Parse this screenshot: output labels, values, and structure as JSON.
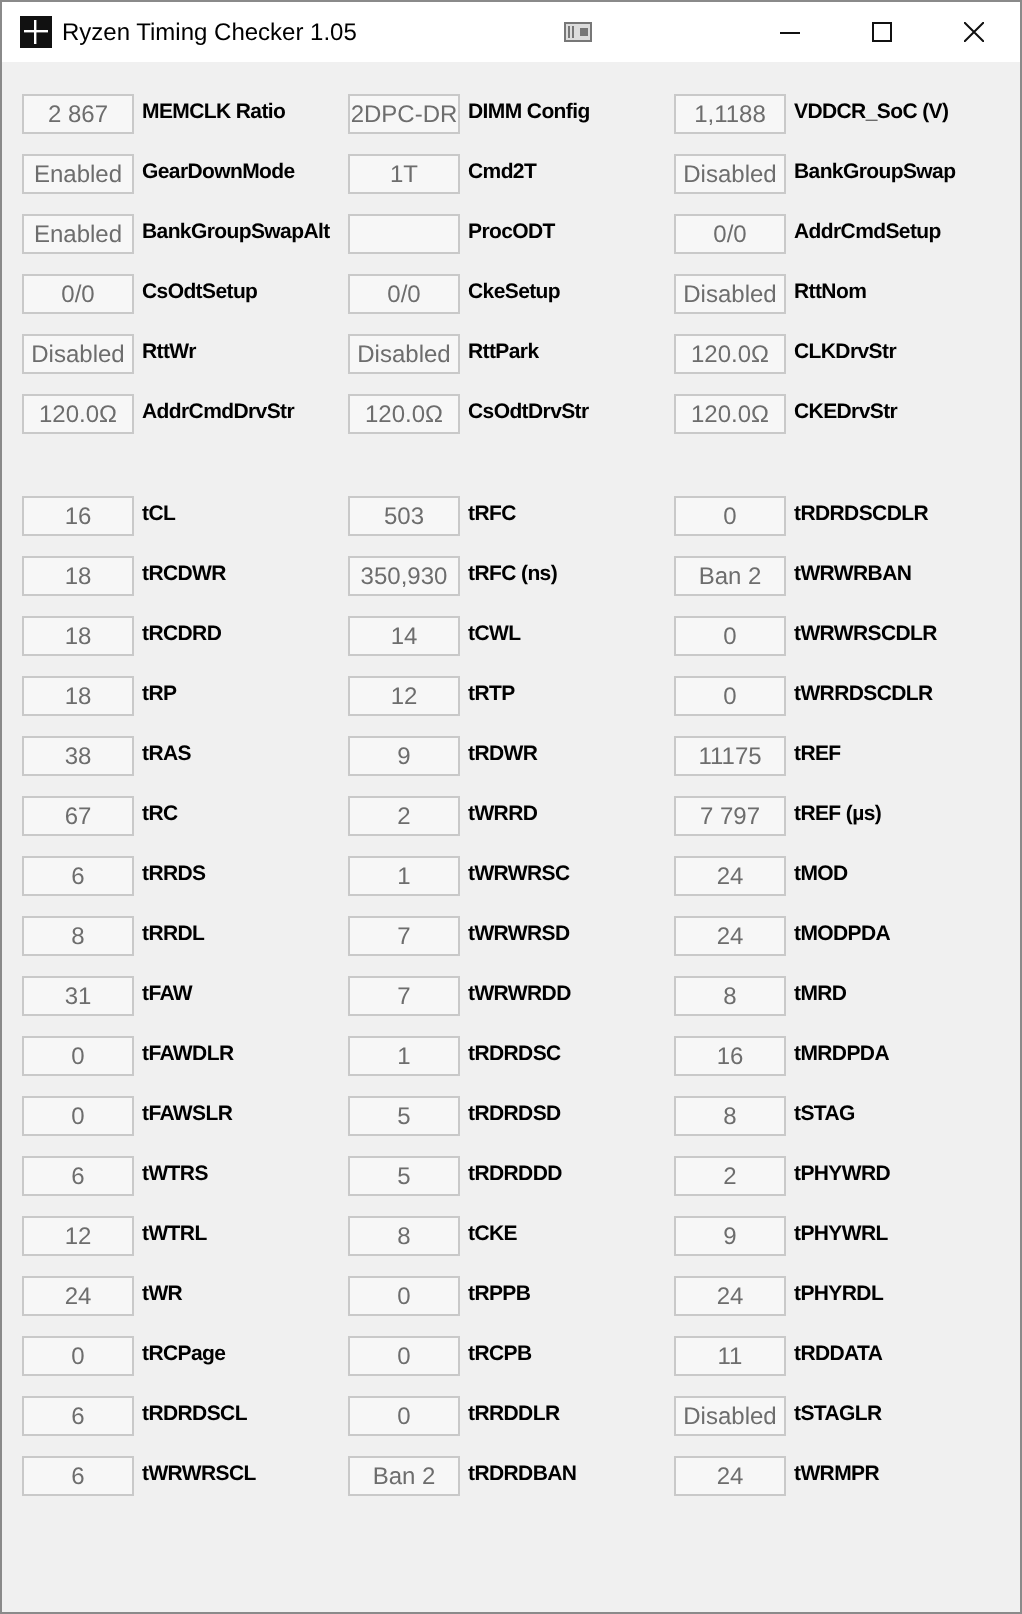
{
  "window": {
    "title": "Ryzen Timing Checker 1.05"
  },
  "sections": [
    {
      "fields": [
        {
          "value": "2 867",
          "label": "MEMCLK Ratio"
        },
        {
          "value": "2DPC-DR",
          "label": "DIMM Config"
        },
        {
          "value": "1,1188",
          "label": "VDDCR_SoC (V)"
        },
        {
          "value": "Enabled",
          "label": "GearDownMode"
        },
        {
          "value": "1T",
          "label": "Cmd2T"
        },
        {
          "value": "Disabled",
          "label": "BankGroupSwap"
        },
        {
          "value": "Enabled",
          "label": "BankGroupSwapAlt"
        },
        {
          "label": "ProcODT"
        },
        {
          "value": "0/0",
          "label": "AddrCmdSetup"
        },
        {
          "value": "0/0",
          "label": "CsOdtSetup"
        },
        {
          "value": "0/0",
          "label": "CkeSetup"
        },
        {
          "value": "Disabled",
          "label": "RttNom"
        },
        {
          "value": "Disabled",
          "label": "RttWr"
        },
        {
          "value": "Disabled",
          "label": "RttPark"
        },
        {
          "value": "120.0Ω",
          "label": "CLKDrvStr"
        },
        {
          "value": "120.0Ω",
          "label": "AddrCmdDrvStr"
        },
        {
          "value": "120.0Ω",
          "label": "CsOdtDrvStr"
        },
        {
          "value": "120.0Ω",
          "label": "CKEDrvStr"
        }
      ]
    },
    {
      "fields": [
        {
          "value": "16",
          "label": "tCL"
        },
        {
          "value": "503",
          "label": "tRFC"
        },
        {
          "value": "0",
          "label": "tRDRDSCDLR"
        },
        {
          "value": "18",
          "label": "tRCDWR"
        },
        {
          "value": "350,930",
          "label": "tRFC (ns)"
        },
        {
          "value": "Ban 2",
          "label": "tWRWRBAN"
        },
        {
          "value": "18",
          "label": "tRCDRD"
        },
        {
          "value": "14",
          "label": "tCWL"
        },
        {
          "value": "0",
          "label": "tWRWRSCDLR"
        },
        {
          "value": "18",
          "label": "tRP"
        },
        {
          "value": "12",
          "label": "tRTP"
        },
        {
          "value": "0",
          "label": "tWRRDSCDLR"
        },
        {
          "value": "38",
          "label": "tRAS"
        },
        {
          "value": "9",
          "label": "tRDWR"
        },
        {
          "value": "11175",
          "label": "tREF"
        },
        {
          "value": "67",
          "label": "tRC"
        },
        {
          "value": "2",
          "label": "tWRRD"
        },
        {
          "value": "7 797",
          "label": "tREF (µs)"
        },
        {
          "value": "6",
          "label": "tRRDS"
        },
        {
          "value": "1",
          "label": "tWRWRSC"
        },
        {
          "value": "24",
          "label": "tMOD"
        },
        {
          "value": "8",
          "label": "tRRDL"
        },
        {
          "value": "7",
          "label": "tWRWRSD"
        },
        {
          "value": "24",
          "label": "tMODPDA"
        },
        {
          "value": "31",
          "label": "tFAW"
        },
        {
          "value": "7",
          "label": "tWRWRDD"
        },
        {
          "value": "8",
          "label": "tMRD"
        },
        {
          "value": "0",
          "label": "tFAWDLR"
        },
        {
          "value": "1",
          "label": "tRDRDSC"
        },
        {
          "value": "16",
          "label": "tMRDPDA"
        },
        {
          "value": "0",
          "label": "tFAWSLR"
        },
        {
          "value": "5",
          "label": "tRDRDSD"
        },
        {
          "value": "8",
          "label": "tSTAG"
        },
        {
          "value": "6",
          "label": "tWTRS"
        },
        {
          "value": "5",
          "label": "tRDRDDD"
        },
        {
          "value": "2",
          "label": "tPHYWRD"
        },
        {
          "value": "12",
          "label": "tWTRL"
        },
        {
          "value": "8",
          "label": "tCKE"
        },
        {
          "value": "9",
          "label": "tPHYWRL"
        },
        {
          "value": "24",
          "label": "tWR"
        },
        {
          "value": "0",
          "label": "tRPPB"
        },
        {
          "value": "24",
          "label": "tPHYRDL"
        },
        {
          "value": "0",
          "label": "tRCPage"
        },
        {
          "value": "0",
          "label": "tRCPB"
        },
        {
          "value": "11",
          "label": "tRDDATA"
        },
        {
          "value": "6",
          "label": "tRDRDSCL"
        },
        {
          "value": "0",
          "label": "tRRDDLR"
        },
        {
          "value": "Disabled",
          "label": "tSTAGLR"
        },
        {
          "value": "6",
          "label": "tWRWRSCL"
        },
        {
          "value": "Ban 2",
          "label": "tRDRDBAN"
        },
        {
          "value": "24",
          "label": "tWRMPR"
        }
      ]
    }
  ]
}
